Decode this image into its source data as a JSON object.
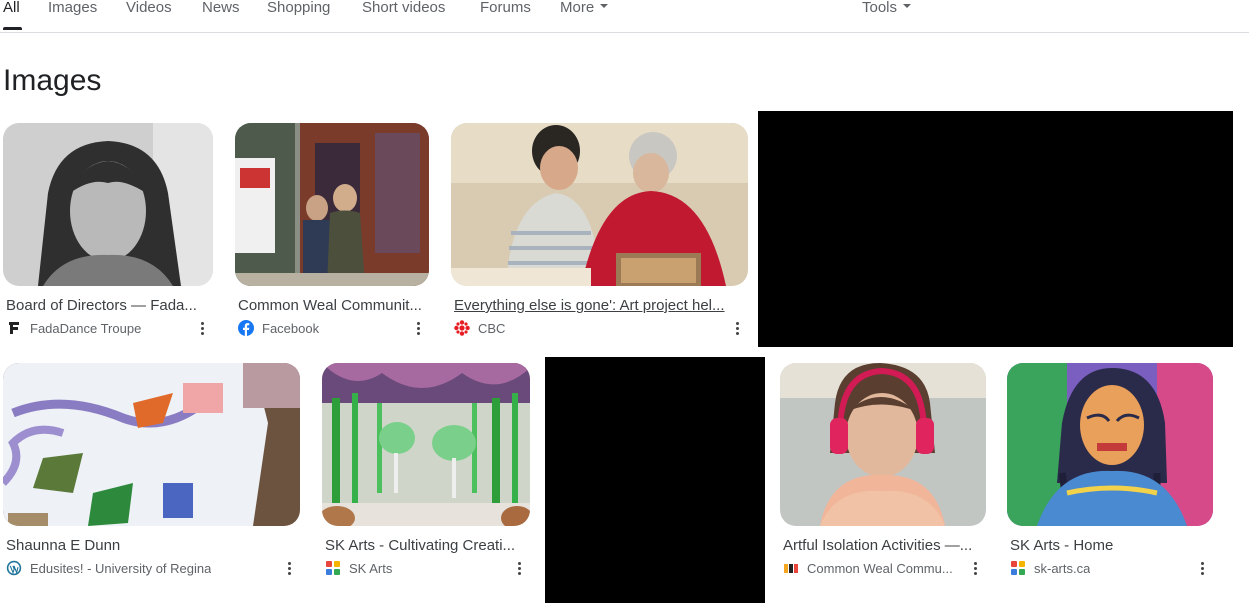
{
  "tabs": [
    {
      "label": "All",
      "active": true
    },
    {
      "label": "Images"
    },
    {
      "label": "Videos"
    },
    {
      "label": "News"
    },
    {
      "label": "Shopping"
    },
    {
      "label": "Short videos"
    },
    {
      "label": "Forums"
    },
    {
      "label": "More",
      "dropdown": true
    }
  ],
  "tools_label": "Tools",
  "section_title": "Images",
  "results": [
    {
      "caption": "Board of Directors — Fada...",
      "source": "FadaDance Troupe",
      "icon": "fadadance-icon"
    },
    {
      "caption": "Common Weal Communit...",
      "source": "Facebook",
      "icon": "facebook-icon"
    },
    {
      "caption": "Everything else is gone': Art project hel...",
      "source": "CBC",
      "icon": "cbc-icon"
    },
    {
      "caption": "Shaunna E Dunn",
      "source": "Edusites! - University of Regina",
      "icon": "wordpress-icon"
    },
    {
      "caption": "SK Arts - Cultivating Creati...",
      "source": "SK Arts",
      "icon": "sk-arts-icon"
    },
    {
      "caption": "Artful Isolation Activities —...",
      "source": "Common Weal Commu...",
      "icon": "common-weal-icon"
    },
    {
      "caption": "SK Arts - Home",
      "source": "sk-arts.ca",
      "icon": "sk-arts-icon"
    }
  ],
  "colors": {
    "facebook": "#1877f2",
    "cbc": "#e61e24",
    "wordpress": "#21759b",
    "text": "#202124",
    "muted": "#5f6368"
  }
}
